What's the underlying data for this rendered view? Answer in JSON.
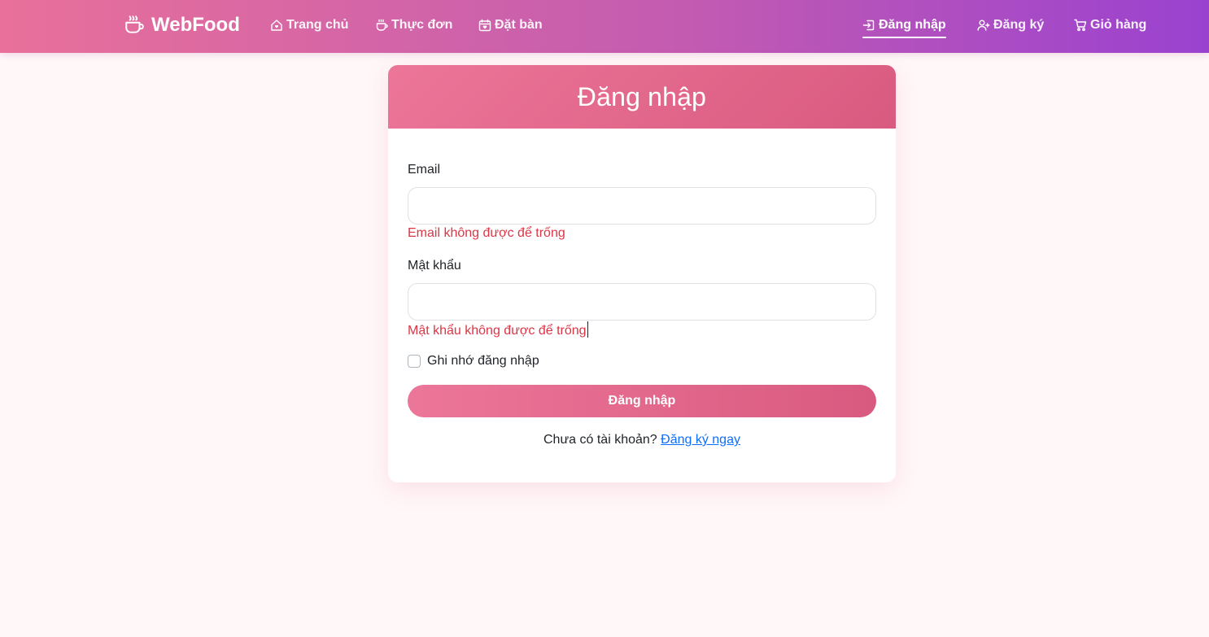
{
  "brand": {
    "name": "WebFood",
    "icon": "coffee-cup-icon"
  },
  "nav": {
    "left": [
      {
        "label": "Trang chủ",
        "icon": "house-heart-icon"
      },
      {
        "label": "Thực đơn",
        "icon": "cup-hot-icon"
      },
      {
        "label": "Đặt bàn",
        "icon": "calendar-heart-icon"
      }
    ],
    "right": [
      {
        "label": "Đăng nhập",
        "icon": "box-arrow-in-right-icon",
        "active": true
      },
      {
        "label": "Đăng ký",
        "icon": "person-plus-icon"
      },
      {
        "label": "Giỏ hàng",
        "icon": "cart-icon"
      }
    ]
  },
  "login": {
    "title": "Đăng nhập",
    "email": {
      "label": "Email",
      "value": "",
      "error": "Email không được để trống"
    },
    "password": {
      "label": "Mật khẩu",
      "value": "",
      "error": "Mật khẩu không được để trống"
    },
    "remember": {
      "label": "Ghi nhớ đăng nhập",
      "checked": false
    },
    "submit_label": "Đăng nhập",
    "signup_prompt": "Chưa có tài khoản?",
    "signup_link": "Đăng ký ngay"
  },
  "colors": {
    "nav_gradient_start": "#e8709a",
    "nav_gradient_end": "#9a42d0",
    "accent": "#d95a80",
    "error": "#dc3545",
    "link": "#0d6efd",
    "page_bg": "#fff7f8"
  }
}
